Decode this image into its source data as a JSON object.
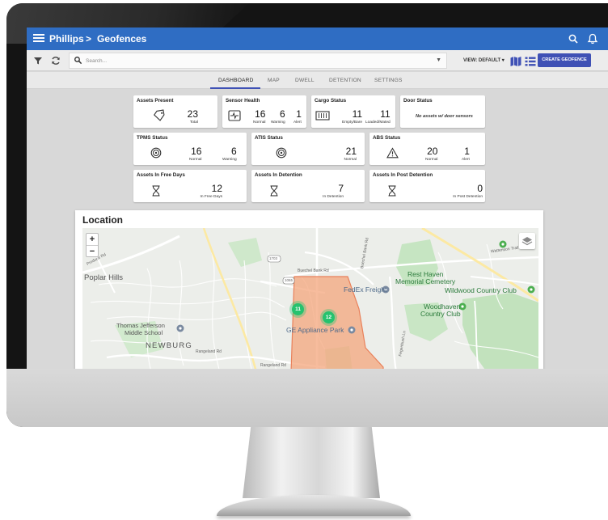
{
  "appbar": {
    "crumbs": [
      "Phillips",
      ">",
      "Geofences"
    ],
    "icons": [
      "menu-icon",
      "search-icon",
      "bell-icon"
    ],
    "color": "#2f6dc3"
  },
  "toolbar": {
    "search_placeholder": "Search...",
    "view_label": "VIEW: DEFAULT ▾",
    "create_label": "CREATE GEOFENCE",
    "icons": [
      "filter-icon",
      "refresh-icon",
      "map-view-icon",
      "list-view-icon"
    ],
    "accent": "#3f51b5"
  },
  "tabs": [
    {
      "label": "DASHBOARD",
      "active": true
    },
    {
      "label": "MAP",
      "active": false
    },
    {
      "label": "DWELL",
      "active": false
    },
    {
      "label": "DETENTION",
      "active": false
    },
    {
      "label": "SETTINGS",
      "active": false
    }
  ],
  "cards": {
    "assets_present": {
      "title": "Assets Present",
      "value": "23",
      "label": "Total"
    },
    "sensor_health": {
      "title": "Sensor Health",
      "metrics": [
        {
          "value": "16",
          "label": "Normal"
        },
        {
          "value": "6",
          "label": "Warning"
        },
        {
          "value": "1",
          "label": "Alert"
        }
      ]
    },
    "cargo_status": {
      "title": "Cargo Status",
      "metrics": [
        {
          "value": "11",
          "label": "Empty/Bare"
        },
        {
          "value": "11",
          "label": "Loaded/Mated"
        }
      ]
    },
    "door_status": {
      "title": "Door Status",
      "note": "No assets w/ door sensors"
    },
    "tpms_status": {
      "title": "TPMS Status",
      "metrics": [
        {
          "value": "16",
          "label": "Normal"
        },
        {
          "value": "6",
          "label": "Warning"
        }
      ]
    },
    "atis_status": {
      "title": "ATIS Status",
      "value": "21",
      "label": "Normal"
    },
    "abs_status": {
      "title": "ABS Status",
      "metrics": [
        {
          "value": "20",
          "label": "Normal"
        },
        {
          "value": "1",
          "label": "Alert"
        }
      ]
    },
    "free_days": {
      "title": "Assets In Free Days",
      "value": "12",
      "label": "In Free Days"
    },
    "detention": {
      "title": "Assets In Detention",
      "value": "7",
      "label": "In Detention"
    },
    "post_detention": {
      "title": "Assets In Post Detention",
      "value": "0",
      "label": "In Post Detention"
    }
  },
  "location": {
    "title": "Location",
    "zoom_in": "+",
    "zoom_out": "−",
    "labels": {
      "poplar_hills": "Poplar Hills",
      "thomas_jefferson": "Thomas Jefferson",
      "middle_school": "Middle School",
      "newburg": "NEWBURG",
      "rest_haven": "Rest Haven",
      "memorial_cemetery": "Memorial Cemetery",
      "wildwood": "Wildwood Country Club",
      "woodhaven": "Woodhaven",
      "country_club": "Country Club",
      "fedex": "FedEx Freight",
      "ge_park": "GE Appliance Park",
      "produce_rd": "Produce Rd",
      "buechel_bank_rd": "Buechel Bank Rd",
      "rangeland_rd": "Rangeland Rd",
      "rangeland_rd_2": "Rangeland Rd",
      "wattenson_trl": "Wattenson Trail",
      "fegenbush_ln": "Fegenbush Ln",
      "shield_1703": "1703",
      "shield_1065": "1065"
    },
    "clusters": [
      {
        "count": "11"
      },
      {
        "count": "12"
      }
    ],
    "geofence_color": "#f4a57c",
    "cluster_color": "#26c26e"
  }
}
